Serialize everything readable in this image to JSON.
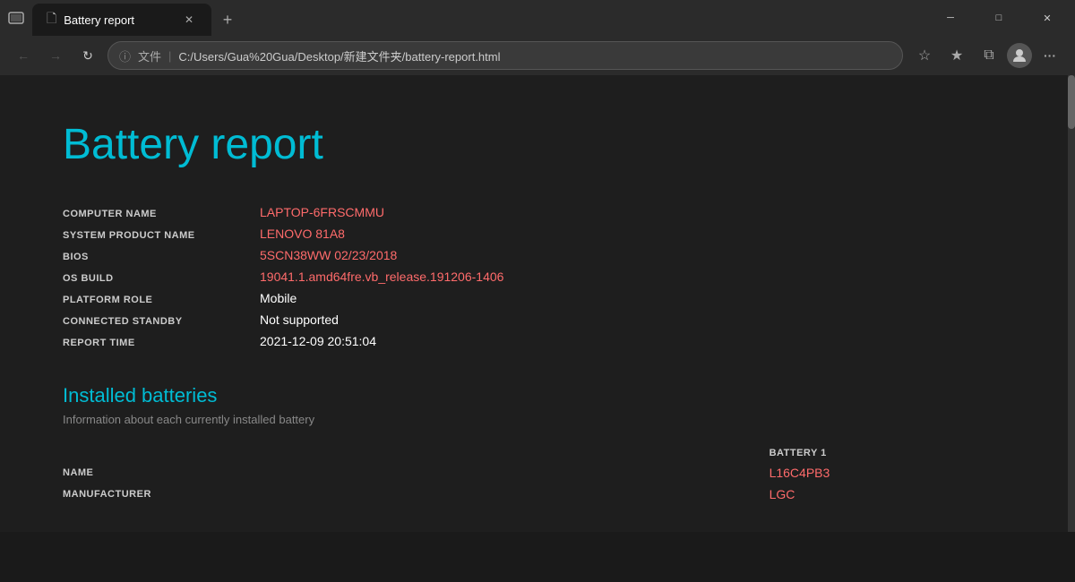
{
  "browser": {
    "tab_title": "Battery report",
    "new_tab_icon": "+",
    "address_bar": {
      "info_icon": "ⓘ",
      "file_label": "文件",
      "separator": "|",
      "url": "C:/Users/Gua%20Gua/Desktop/新建文件夹/battery-report.html"
    },
    "nav": {
      "back": "←",
      "forward": "→",
      "refresh": "↻"
    },
    "window_controls": {
      "minimize": "─",
      "maximize": "□",
      "close": "✕"
    }
  },
  "page": {
    "title": "Battery report",
    "system_info": {
      "rows": [
        {
          "label": "COMPUTER NAME",
          "value": "LAPTOP-6FRSCMMU",
          "color": "red"
        },
        {
          "label": "SYSTEM PRODUCT NAME",
          "value": "LENOVO 81A8",
          "color": "red"
        },
        {
          "label": "BIOS",
          "value": "5SCN38WW 02/23/2018",
          "color": "red"
        },
        {
          "label": "OS BUILD",
          "value": "19041.1.amd64fre.vb_release.191206-1406",
          "color": "red"
        },
        {
          "label": "PLATFORM ROLE",
          "value": "Mobile",
          "color": "white"
        },
        {
          "label": "CONNECTED STANDBY",
          "value": "Not supported",
          "color": "white"
        },
        {
          "label": "REPORT TIME",
          "value": "2021-12-09  20:51:04",
          "color": "white"
        }
      ]
    },
    "installed_batteries": {
      "section_title": "Installed batteries",
      "section_subtitle": "Information about each currently installed battery",
      "battery_header": "BATTERY 1",
      "rows": [
        {
          "label": "NAME",
          "value": "L16C4PB3",
          "color": "red"
        },
        {
          "label": "MANUFACTURER",
          "value": "LGC",
          "color": "red"
        }
      ]
    }
  }
}
